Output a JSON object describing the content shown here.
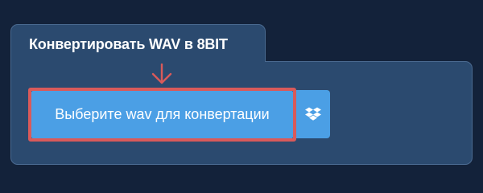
{
  "converter": {
    "tab_title": "Конвертировать WAV в 8BIT",
    "choose_button_label": "Выберите wav для конвертации"
  },
  "icons": {
    "arrow": "arrow-down-icon",
    "dropbox": "dropbox-icon"
  },
  "colors": {
    "page_background": "#13223a",
    "panel_background": "#2b4a6f",
    "button_background": "#4b9fe5",
    "highlight": "#d95a5a"
  }
}
